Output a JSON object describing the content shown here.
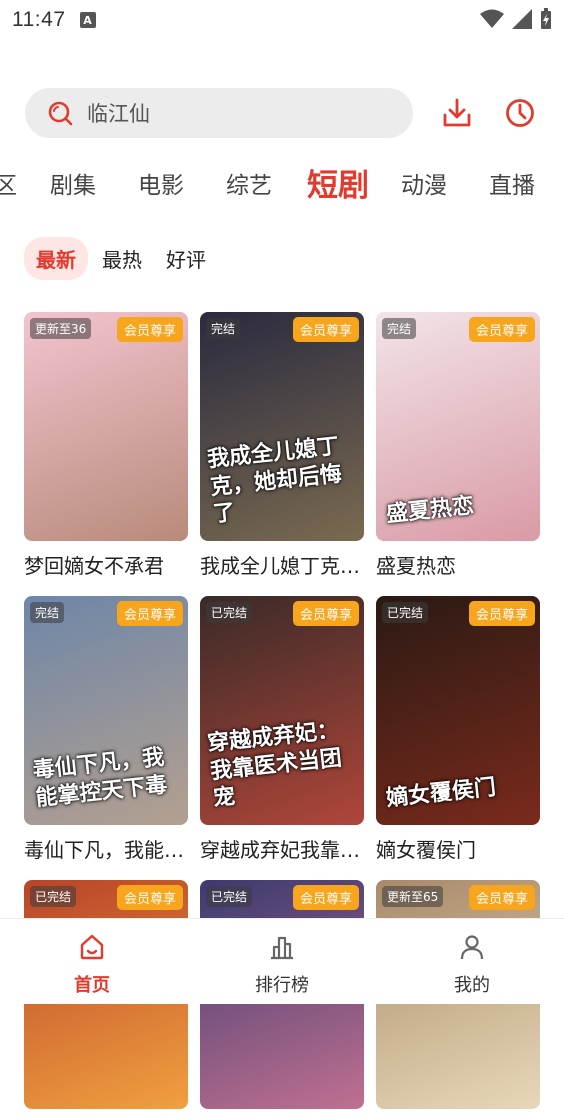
{
  "status_bar": {
    "time": "11:47",
    "notice_icon": "A"
  },
  "search": {
    "placeholder": "临江仙"
  },
  "categories": [
    "区",
    "剧集",
    "电影",
    "综艺",
    "短剧",
    "动漫",
    "直播"
  ],
  "active_category": "短剧",
  "sort_tabs": [
    "最新",
    "最热",
    "好评"
  ],
  "active_sort": "最新",
  "cards": [
    {
      "title": "梦回嫡女不承君",
      "status": "更新至36",
      "vip": "会员尊享",
      "colors": [
        "#f3c4cf",
        "#b98a7a"
      ]
    },
    {
      "title": "我成全儿媳丁克…",
      "status": "完结",
      "vip": "会员尊享",
      "poster_text": "我成全儿媳丁克，她却后悔了",
      "colors": [
        "#2a2a40",
        "#7a6a50"
      ]
    },
    {
      "title": "盛夏热恋",
      "status": "完结",
      "vip": "会员尊享",
      "poster_text": "盛夏热恋",
      "colors": [
        "#f2e4e8",
        "#d99aa5"
      ]
    },
    {
      "title": "毒仙下凡，我能…",
      "status": "完结",
      "vip": "会员尊享",
      "poster_text": "毒仙下凡，我能掌控天下毒",
      "colors": [
        "#6d86a8",
        "#b4a090"
      ]
    },
    {
      "title": "穿越成弃妃我靠…",
      "status": "已完结",
      "vip": "会员尊享",
      "poster_text": "穿越成弃妃：我靠医术当团宠",
      "colors": [
        "#3a2a28",
        "#b0463a"
      ]
    },
    {
      "title": "嫡女覆侯门",
      "status": "已完结",
      "vip": "会员尊享",
      "poster_text": "嫡女覆侯门",
      "colors": [
        "#2a1a14",
        "#7a2a1c"
      ]
    },
    {
      "title": "",
      "status": "已完结",
      "vip": "会员尊享",
      "poster_text": "",
      "colors": [
        "#b94428",
        "#f0a040"
      ]
    },
    {
      "title": "",
      "status": "已完结",
      "vip": "会员尊享",
      "poster_text": "",
      "colors": [
        "#3c3a70",
        "#c07090"
      ]
    },
    {
      "title": "",
      "status": "更新至65",
      "vip": "会员尊享",
      "poster_text": "",
      "colors": [
        "#a88a6a",
        "#e8d8b8"
      ]
    }
  ],
  "bottom_nav": [
    {
      "label": "首页",
      "icon": "home-icon"
    },
    {
      "label": "排行榜",
      "icon": "ranking-icon"
    },
    {
      "label": "我的",
      "icon": "profile-icon"
    }
  ],
  "accent_color": "#e23b2e",
  "vip_badge_color": "#f7a51c"
}
